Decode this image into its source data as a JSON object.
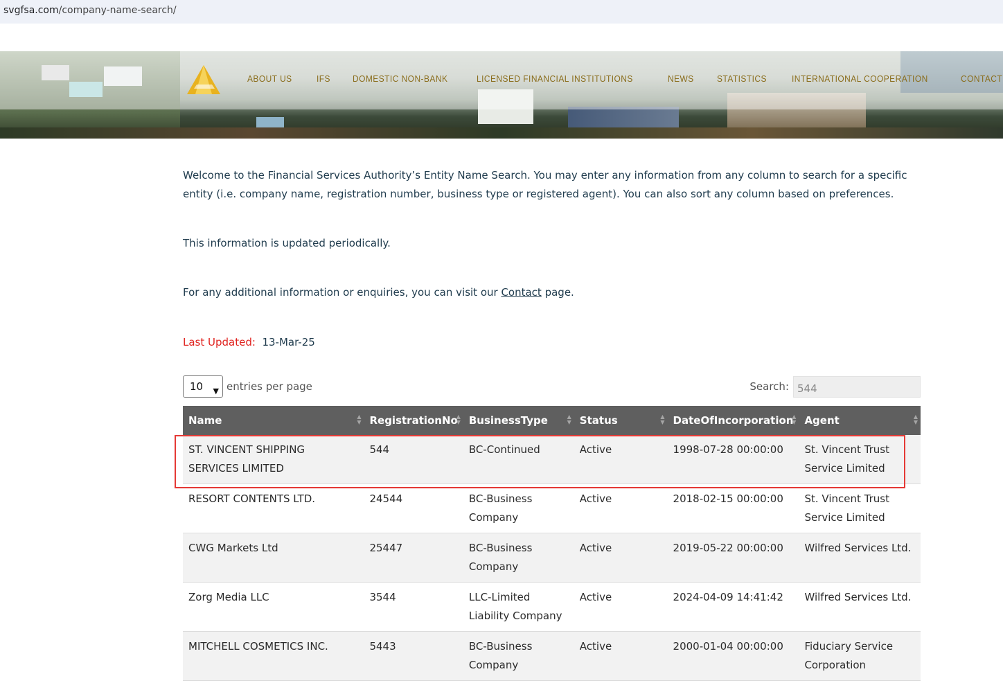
{
  "browser": {
    "url_domain": "svgfsa.com",
    "url_path": "/company-name-search/"
  },
  "nav": [
    "ABOUT US",
    "IFS",
    "DOMESTIC NON-BANK",
    "LICENSED FINANCIAL INSTITUTIONS",
    "NEWS",
    "STATISTICS",
    "INTERNATIONAL COOPERATION",
    "CONTACT US"
  ],
  "intro": {
    "welcome": "Welcome to the Financial Services Authority’s Entity Name Search. You may enter any information from any column to search for a specific entity (i.e. company name, registration number, business type or registered agent). You can also sort any column based on preferences.",
    "updated_note": "This information is updated periodically.",
    "enquiry_before": "For any additional information or enquiries, you can visit our ",
    "enquiry_link": "Contact",
    "enquiry_after": " page."
  },
  "last_updated": {
    "label": "Last Updated:",
    "value": "13-Mar-25"
  },
  "controls": {
    "entries_value": "10",
    "entries_label": "entries per page",
    "search_label": "Search:",
    "search_value": "544"
  },
  "table": {
    "columns": [
      "Name",
      "RegistrationNo",
      "BusinessType",
      "Status",
      "DateOfIncorporation",
      "Agent"
    ],
    "rows": [
      [
        "ST. VINCENT SHIPPING SERVICES LIMITED",
        "544",
        "BC-Continued",
        "Active",
        "1998-07-28 00:00:00",
        "St. Vincent Trust Service Limited"
      ],
      [
        "RESORT CONTENTS LTD.",
        "24544",
        "BC-Business Company",
        "Active",
        "2018-02-15 00:00:00",
        "St. Vincent Trust Service Limited"
      ],
      [
        "CWG Markets Ltd",
        "25447",
        "BC-Business Company",
        "Active",
        "2019-05-22 00:00:00",
        "Wilfred Services Ltd."
      ],
      [
        "Zorg Media LLC",
        "3544",
        "LLC-Limited Liability Company",
        "Active",
        "2024-04-09 14:41:42",
        "Wilfred Services Ltd."
      ],
      [
        "MITCHELL COSMETICS INC.",
        "5443",
        "BC-Business Company",
        "Active",
        "2000-01-04 00:00:00",
        "Fiduciary Service Corporation"
      ]
    ]
  },
  "colors": {
    "accent_red": "#e0231f",
    "nav_gold": "#8a6d1c",
    "header_gray": "#5f5f5f",
    "highlight_box": "#e53935"
  }
}
